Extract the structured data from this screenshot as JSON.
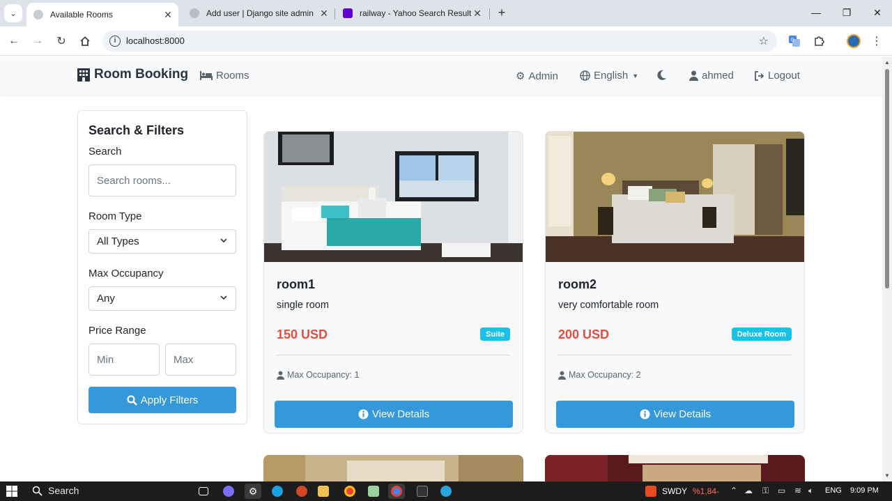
{
  "browser": {
    "tabs": [
      {
        "title": "Available Rooms",
        "active": true
      },
      {
        "title": "Add user | Django site admin",
        "active": false
      },
      {
        "title": "railway - Yahoo Search Results",
        "active": false
      }
    ],
    "url": "localhost:8000"
  },
  "navbar": {
    "brand": "Room Booking",
    "rooms": "Rooms",
    "admin": "Admin",
    "language": "English",
    "user": "ahmed",
    "logout": "Logout"
  },
  "filters": {
    "title": "Search & Filters",
    "search_label": "Search",
    "search_placeholder": "Search rooms...",
    "room_type_label": "Room Type",
    "room_type_value": "All Types",
    "occupancy_label": "Max Occupancy",
    "occupancy_value": "Any",
    "price_label": "Price Range",
    "min_placeholder": "Min",
    "max_placeholder": "Max",
    "apply": "Apply Filters"
  },
  "rooms": [
    {
      "name": "room1",
      "description": "single room",
      "price": "150 USD",
      "type": "Suite",
      "occupancy": "Max Occupancy: 1",
      "button": "View Details"
    },
    {
      "name": "room2",
      "description": "very comfortable room",
      "price": "200 USD",
      "type": "Deluxe Room",
      "occupancy": "Max Occupancy: 2",
      "button": "View Details"
    }
  ],
  "taskbar": {
    "search": "Search",
    "ticker": "SWDY",
    "ticker_change": "%1,84-",
    "language": "ENG",
    "time": "9:09 PM"
  },
  "colors": {
    "primary": "#3498db",
    "price": "#e74c3c",
    "badge": "#17c1e8",
    "navbar_bg": "#f8f9fa"
  }
}
